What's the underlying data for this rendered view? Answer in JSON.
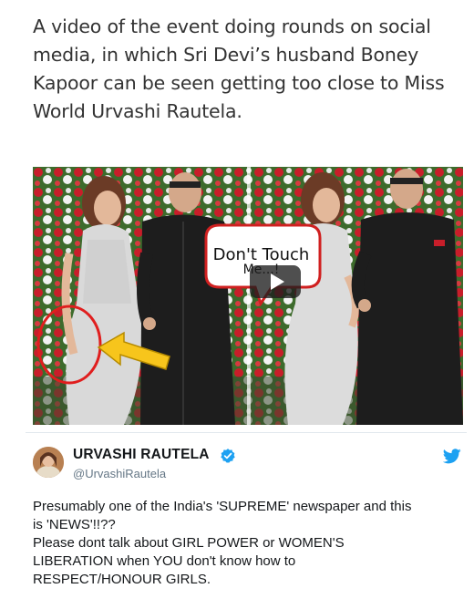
{
  "article": {
    "caption": "A video of the event doing rounds on social media, in which Sri Devi’s husband Boney Kapoor can be seen getting too close to Miss World Urvashi Rautela."
  },
  "video": {
    "bubble_line1": "Don't Touch",
    "bubble_line2": "Me...!",
    "play_icon": "play-icon",
    "annotation_colors": {
      "circle": "#e01e1e",
      "arrow": "#f7c51c"
    }
  },
  "tweet": {
    "name": "URVASHI RAUTELA",
    "handle": "@UrvashiRautela",
    "verified_icon": "verified-badge-icon",
    "platform_icon": "twitter-bird-icon",
    "body_lines": [
      "Presumably one of the India's 'SUPREME' newspaper and this",
      "is 'NEWS'!!??",
      "Please dont talk about GIRL POWER or WOMEN'S",
      "LIBERATION when YOU don't know how to",
      "RESPECT/HONOUR GIRLS."
    ],
    "colors": {
      "brand": "#1da1f2",
      "text": "#14171a",
      "muted": "#657786"
    }
  }
}
